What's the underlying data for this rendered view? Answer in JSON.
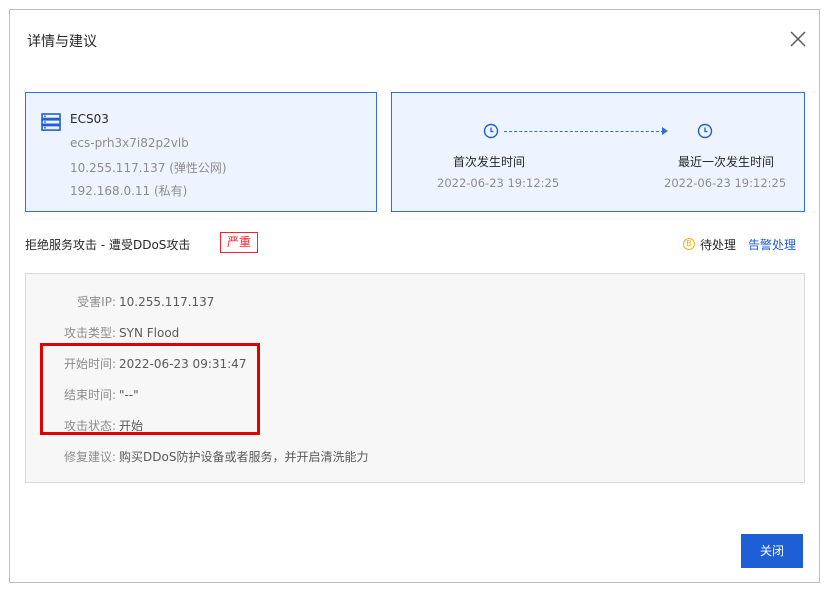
{
  "dialog": {
    "title": "详情与建议",
    "close_label": "关闭"
  },
  "asset": {
    "name": "ECS03",
    "instance_id": "ecs-prh3x7i82p2vlb",
    "public_ip": "10.255.117.137 (弹性公网)",
    "private_ip": "192.168.0.11 (私有)"
  },
  "timeline": {
    "first_label": "首次发生时间",
    "first_value": "2022-06-23 19:12:25",
    "last_label": "最近一次发生时间",
    "last_value": "2022-06-23 19:12:25"
  },
  "event": {
    "title": "拒绝服务攻击 - 遭受DDoS攻击",
    "severity": "严重",
    "status_icon_glyph": "B",
    "status": "待处理",
    "action": "告警处理"
  },
  "details": [
    {
      "label": "受害IP:",
      "value": "10.255.117.137"
    },
    {
      "label": "攻击类型:",
      "value": "SYN Flood"
    },
    {
      "label": "开始时间:",
      "value": "2022-06-23 09:31:47"
    },
    {
      "label": "结束时间:",
      "value": "\"--\""
    },
    {
      "label": "攻击状态:",
      "value": "开始"
    },
    {
      "label": "修复建议:",
      "value": "购买DDoS防护设备或者服务，并开启清洗能力"
    }
  ],
  "colors": {
    "accent": "#1f5fd6",
    "card_bg": "#eef4ff",
    "danger": "#f5222d",
    "warning": "#faad14",
    "highlight": "#e00000"
  }
}
